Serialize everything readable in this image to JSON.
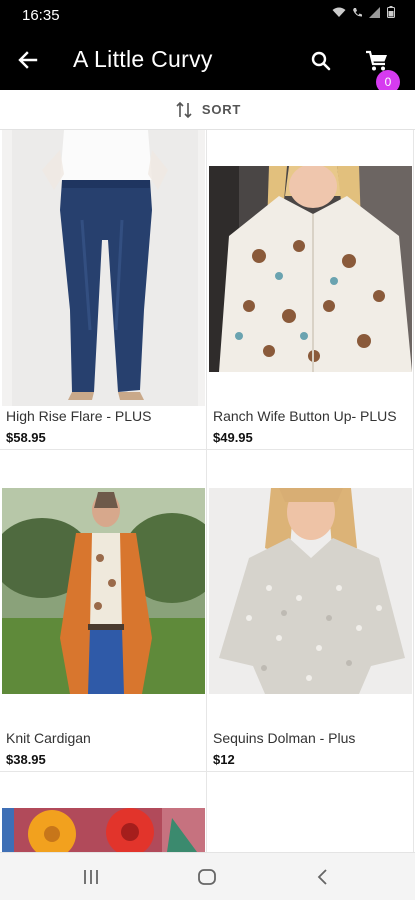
{
  "status_bar": {
    "time": "16:35"
  },
  "app_bar": {
    "title": "A Little Curvy",
    "cart_count": "0",
    "accent": "#d63bf0"
  },
  "sort_bar": {
    "label": "SORT"
  },
  "products": [
    {
      "name": "High Rise Flare - PLUS",
      "price": "$58.95"
    },
    {
      "name": "Ranch Wife Button Up- PLUS",
      "price": "$49.95"
    },
    {
      "name": "Knit Cardigan",
      "price": "$38.95"
    },
    {
      "name": "Sequins Dolman - Plus",
      "price": "$12"
    }
  ],
  "icons": {
    "back": "arrow-left-icon",
    "search": "search-icon",
    "cart": "cart-icon",
    "sort": "sort-icon",
    "nav_recents": "recents-icon",
    "nav_home": "home-icon",
    "nav_back": "nav-back-icon"
  }
}
